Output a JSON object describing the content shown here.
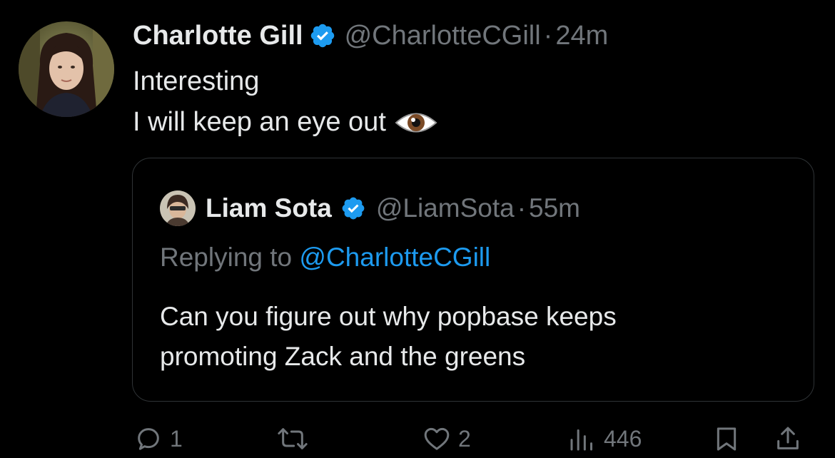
{
  "tweet": {
    "author": {
      "display_name": "Charlotte Gill",
      "handle": "@CharlotteCGill",
      "separator": "·",
      "time": "24m",
      "verified": true
    },
    "lines": [
      "Interesting",
      "I will keep an eye out"
    ],
    "emoji": "eye-emoji"
  },
  "quote": {
    "author": {
      "display_name": "Liam Sota",
      "handle": "@LiamSota",
      "separator": "·",
      "time": "55m",
      "verified": true
    },
    "replying_prefix": "Replying to",
    "replying_to": "@CharlotteCGill",
    "lines": [
      "Can you figure out why popbase keeps",
      "promoting Zack and the greens"
    ]
  },
  "actions": {
    "reply_count": "1",
    "repost_count": "",
    "like_count": "2",
    "views_count": "446"
  },
  "colors": {
    "background": "#000000",
    "text": "#e7e9ea",
    "muted": "#71767b",
    "accent": "#1d9bf0",
    "border": "#2f3336"
  }
}
